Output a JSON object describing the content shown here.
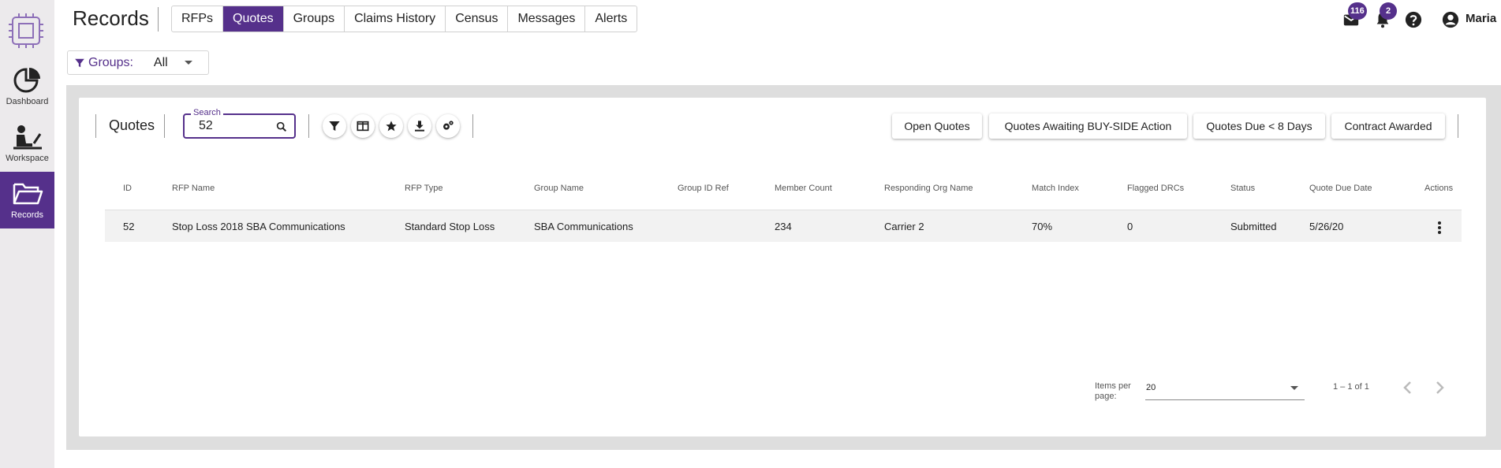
{
  "app": {
    "title": "Records"
  },
  "sidebar": {
    "items": [
      {
        "label": "Dashboard",
        "icon": "pie-chart-icon"
      },
      {
        "label": "Workspace",
        "icon": "person-at-desk-icon"
      },
      {
        "label": "Records",
        "icon": "folder-open-icon"
      }
    ]
  },
  "tabs": [
    {
      "label": "RFPs"
    },
    {
      "label": "Quotes"
    },
    {
      "label": "Groups"
    },
    {
      "label": "Claims History"
    },
    {
      "label": "Census"
    },
    {
      "label": "Messages"
    },
    {
      "label": "Alerts"
    }
  ],
  "header": {
    "mail_badge": "116",
    "notification_badge": "2",
    "user_name": "Maria"
  },
  "groups_filter": {
    "label": "Groups:",
    "value": "All"
  },
  "toolbar": {
    "section_label": "Quotes",
    "search_legend": "Search",
    "search_value": "52",
    "quick_filters": [
      "Open Quotes",
      "Quotes Awaiting BUY-SIDE Action",
      "Quotes Due < 8 Days",
      "Contract Awarded"
    ]
  },
  "table": {
    "columns": [
      "ID",
      "RFP Name",
      "RFP Type",
      "Group Name",
      "Group ID Ref",
      "Member Count",
      "Responding Org Name",
      "Match Index",
      "Flagged DRCs",
      "Status",
      "Quote Due Date",
      "Actions"
    ],
    "rows": [
      [
        "52",
        "Stop Loss 2018 SBA Communications",
        "Standard Stop Loss",
        "SBA Communications",
        "",
        "234",
        "Carrier 2",
        "70%",
        "0",
        "Submitted",
        "5/26/20"
      ]
    ]
  },
  "paginator": {
    "items_per_page_label": "Items per page:",
    "items_per_page_value": "20",
    "range_label": "1 – 1 of 1"
  },
  "colors": {
    "accent": "#55308b",
    "panel_bg": "#dedede",
    "sidebar_bg": "#eceaec"
  }
}
